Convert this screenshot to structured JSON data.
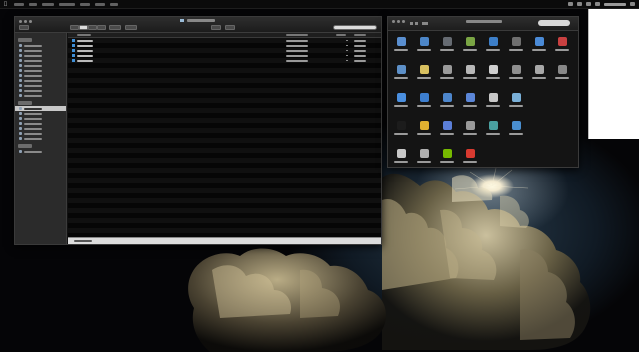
{
  "menubar": {
    "app_menu": "",
    "items": [
      "",
      "",
      "",
      "",
      "",
      ""
    ],
    "clock": ""
  },
  "finder": {
    "title": "",
    "sidebar": {
      "sections": [
        {
          "heading": "",
          "items": [
            "",
            "",
            "",
            "",
            "",
            "",
            "",
            "",
            "",
            "",
            ""
          ]
        },
        {
          "heading": "",
          "items": [
            "",
            "",
            "",
            "",
            "",
            "",
            ""
          ]
        },
        {
          "heading": "",
          "items": [
            ""
          ]
        }
      ],
      "selected_index": 11
    },
    "columns": [
      "",
      "",
      "",
      ""
    ],
    "files": [
      {
        "name": "",
        "date": "",
        "size": "",
        "kind": ""
      },
      {
        "name": "",
        "date": "",
        "size": "",
        "kind": ""
      },
      {
        "name": "",
        "date": "",
        "size": "",
        "kind": ""
      },
      {
        "name": "",
        "date": "",
        "size": "",
        "kind": ""
      },
      {
        "name": "",
        "date": "",
        "size": "",
        "kind": ""
      }
    ],
    "status": ""
  },
  "prefs": {
    "title": "",
    "search_placeholder": "",
    "rows": [
      [
        {
          "icon": "general-icon",
          "label": "",
          "color": "#5a8fd0"
        },
        {
          "icon": "desktop-icon",
          "label": "",
          "color": "#4c86c8"
        },
        {
          "icon": "dock-icon",
          "label": "",
          "color": "#666b72"
        },
        {
          "icon": "mission-control-icon",
          "label": "",
          "color": "#7aa544"
        },
        {
          "icon": "language-icon",
          "label": "",
          "color": "#3d7fc9"
        },
        {
          "icon": "security-icon",
          "label": "",
          "color": "#6f6f6f"
        },
        {
          "icon": "spotlight-icon",
          "label": "",
          "color": "#4a8ad6"
        },
        {
          "icon": "notifications-icon",
          "label": "",
          "color": "#c94040"
        }
      ],
      [
        {
          "icon": "cds-dvds-icon",
          "label": "",
          "color": "#5d90c8"
        },
        {
          "icon": "displays-icon",
          "label": "",
          "color": "#d8c060"
        },
        {
          "icon": "energy-saver-icon",
          "label": "",
          "color": "#9a9a9a"
        },
        {
          "icon": "keyboard-icon",
          "label": "",
          "color": "#b8b8b8"
        },
        {
          "icon": "mouse-icon",
          "label": "",
          "color": "#cfcfcf"
        },
        {
          "icon": "trackpad-icon",
          "label": "",
          "color": "#8f8f8f"
        },
        {
          "icon": "printers-icon",
          "label": "",
          "color": "#a8a8a8"
        },
        {
          "icon": "sound-icon",
          "label": "",
          "color": "#888888"
        }
      ],
      [
        {
          "icon": "icloud-icon",
          "label": "",
          "color": "#4a8fe0"
        },
        {
          "icon": "internet-accounts-icon",
          "label": "",
          "color": "#3d7fd0"
        },
        {
          "icon": "network-icon",
          "label": "",
          "color": "#4d86cc"
        },
        {
          "icon": "bluetooth-icon",
          "label": "",
          "color": "#5b86d8"
        },
        {
          "icon": "sharing-icon",
          "label": "",
          "color": "#c8c8c8"
        },
        {
          "icon": "",
          "label": "",
          "color": "#7ab0d8"
        }
      ],
      [
        {
          "icon": "users-groups-icon",
          "label": "",
          "color": "#1c1c1c"
        },
        {
          "icon": "parental-controls-icon",
          "label": "",
          "color": "#e0b030"
        },
        {
          "icon": "app-store-icon",
          "label": "",
          "color": "#5b7fd8"
        },
        {
          "icon": "dictation-icon",
          "label": "",
          "color": "#9a9a9a"
        },
        {
          "icon": "date-time-icon",
          "label": "",
          "color": "#4aa0a0"
        },
        {
          "icon": "startup-disk-icon",
          "label": "",
          "color": "#4a8fd0"
        }
      ],
      [
        {
          "icon": "flash-player-icon",
          "label": "",
          "color": "#c8c8c8"
        },
        {
          "icon": "",
          "label": "",
          "color": "#b0b0b0"
        },
        {
          "icon": "nvidia-icon",
          "label": "",
          "color": "#76b900"
        },
        {
          "icon": "",
          "label": "",
          "color": "#d83a30"
        }
      ]
    ]
  },
  "blank_window": {}
}
